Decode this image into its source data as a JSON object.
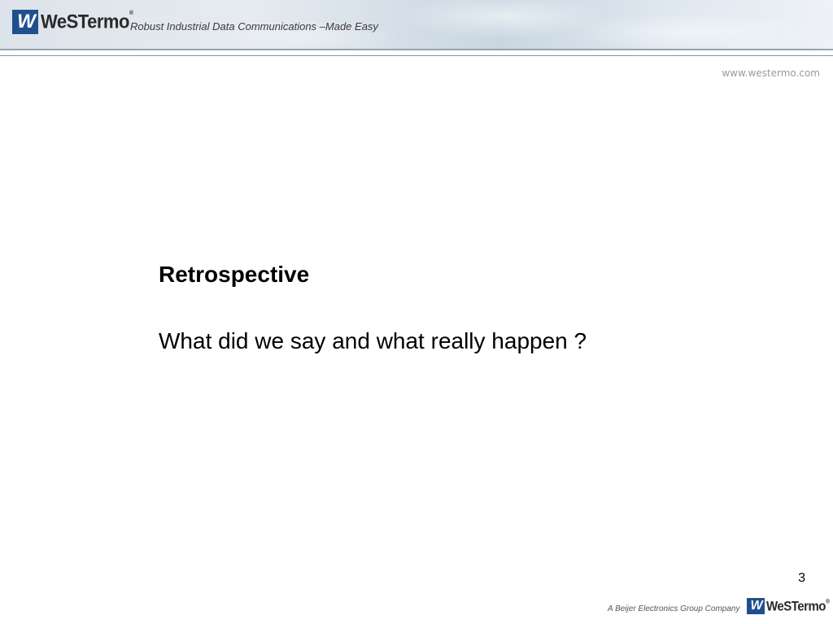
{
  "header": {
    "logo_mark": "W",
    "logo_word": "WeSTermo",
    "logo_reg": "®",
    "tagline": "Robust Industrial Data Communications –Made Easy"
  },
  "url": "www.westermo.com",
  "slide": {
    "title": "Retrospective",
    "subtitle": "What did we say and what really happen ?",
    "page_number": "3"
  },
  "footer": {
    "company_line": "A Beijer Electronics Group Company",
    "logo_mark": "W",
    "logo_word": "WeSTermo",
    "logo_reg": "®"
  },
  "colors": {
    "brand_blue": "#1f4f8f",
    "text": "#000000",
    "url_gray": "#9a9a9a"
  }
}
